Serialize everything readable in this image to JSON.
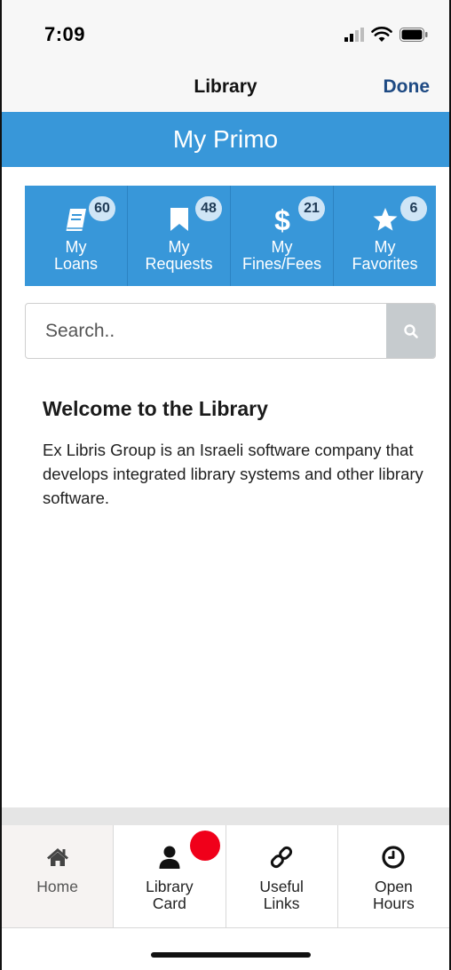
{
  "status_bar": {
    "time": "7:09"
  },
  "nav": {
    "title": "Library",
    "done_label": "Done"
  },
  "header": {
    "title": "My Primo"
  },
  "tiles": [
    {
      "label_line1": "My",
      "label_line2": "Loans",
      "count": "60",
      "icon": "book-icon"
    },
    {
      "label_line1": "My",
      "label_line2": "Requests",
      "count": "48",
      "icon": "bookmark-icon"
    },
    {
      "label_line1": "My",
      "label_line2": "Fines/Fees",
      "count": "21",
      "icon": "dollar-icon"
    },
    {
      "label_line1": "My",
      "label_line2": "Favorites",
      "count": "6",
      "icon": "star-icon"
    }
  ],
  "search": {
    "placeholder": "Search..",
    "value": ""
  },
  "welcome": {
    "title": "Welcome to the Library",
    "body": "Ex Libris Group is an Israeli software company that develops integrated library systems and other library software."
  },
  "tab_bar": {
    "tabs": [
      {
        "label_line1": "Home",
        "label_line2": "",
        "icon": "home-icon",
        "active": true
      },
      {
        "label_line1": "Library",
        "label_line2": "Card",
        "icon": "user-icon",
        "active": false
      },
      {
        "label_line1": "Useful",
        "label_line2": "Links",
        "icon": "link-icon",
        "active": false
      },
      {
        "label_line1": "Open",
        "label_line2": "Hours",
        "icon": "clock-icon",
        "active": false
      }
    ],
    "notification_color": "#f0001a"
  },
  "colors": {
    "accent": "#3897d9",
    "done": "#1e4a83"
  }
}
